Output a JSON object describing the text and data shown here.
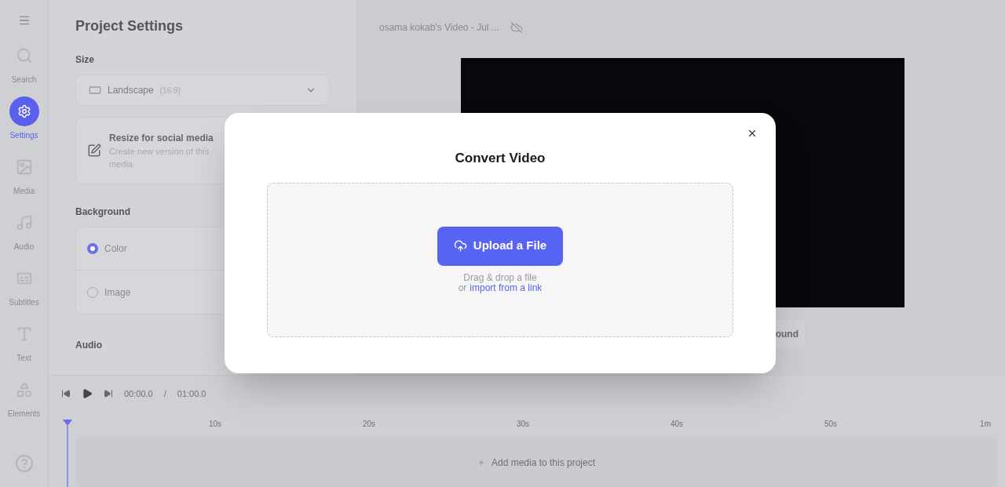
{
  "sidebar": {
    "items": [
      {
        "label": "Search",
        "selected": false
      },
      {
        "label": "Settings",
        "selected": true
      },
      {
        "label": "Media",
        "selected": false
      },
      {
        "label": "Audio",
        "selected": false
      },
      {
        "label": "Subtitles",
        "selected": false
      },
      {
        "label": "Text",
        "selected": false
      },
      {
        "label": "Elements",
        "selected": false
      }
    ]
  },
  "settings": {
    "title": "Project Settings",
    "size_label": "Size",
    "size_value": "Landscape",
    "size_ratio": "(16:9)",
    "resize": {
      "title": "Resize for social media",
      "description": [
        "Create new version of this",
        "media"
      ]
    },
    "background_label": "Background",
    "background_options": [
      {
        "label": "Color",
        "selected": true
      },
      {
        "label": "Image",
        "selected": false
      }
    ],
    "audio_label": "Audio"
  },
  "project": {
    "title": "osama kokab's Video - Jul ...",
    "partial_button": "ound"
  },
  "player": {
    "current": "00:00.0",
    "separator": "/",
    "total": "01:00.0"
  },
  "timeline": {
    "ticks": [
      "10s",
      "20s",
      "30s",
      "40s",
      "50s",
      "1m"
    ],
    "add_media": "Add media to this project"
  },
  "dialog": {
    "title": "Convert Video",
    "upload_button": "Upload a File",
    "hint": "Drag & drop a file",
    "or": "or",
    "link": "import from a link"
  }
}
